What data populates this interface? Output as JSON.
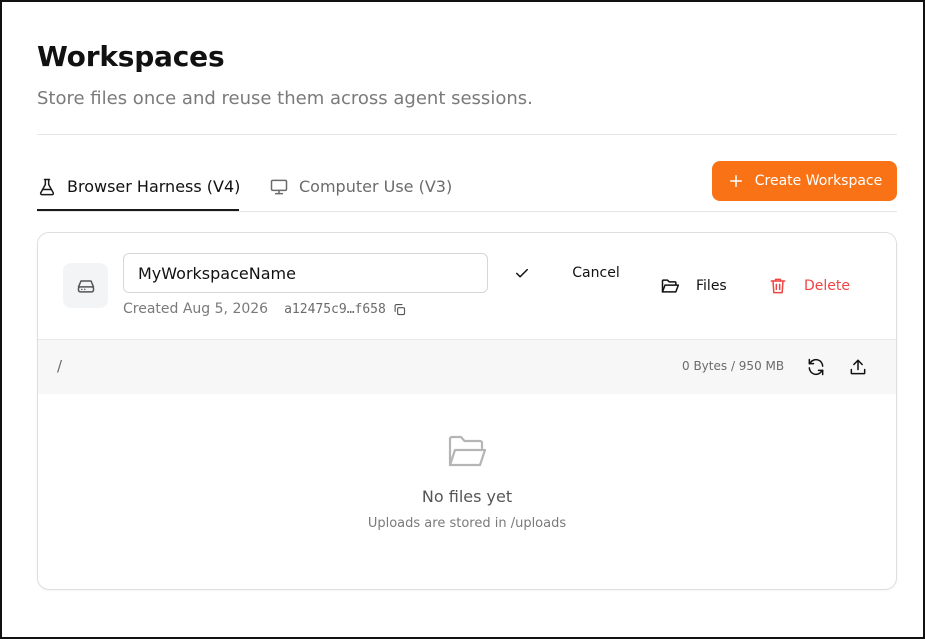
{
  "header": {
    "title": "Workspaces",
    "subtitle": "Store files once and reuse them across agent sessions."
  },
  "tabs": [
    {
      "label": "Browser Harness (V4)",
      "icon": "flask-icon",
      "active": true
    },
    {
      "label": "Computer Use (V3)",
      "icon": "monitor-icon",
      "active": false
    }
  ],
  "actions": {
    "create_label": "Create Workspace",
    "create_icon": "plus-icon"
  },
  "workspace": {
    "name_value": "MyWorkspaceName",
    "created": "Created Aug 5, 2026",
    "hash": "a12475c9…f658",
    "cancel_label": "Cancel",
    "files_label": "Files",
    "delete_label": "Delete"
  },
  "file_browser": {
    "path": "/",
    "usage": "0 Bytes / 950 MB",
    "empty_title": "No files yet",
    "empty_subtitle": "Uploads are stored in /uploads"
  },
  "colors": {
    "accent": "#f97316",
    "danger": "#ef4444",
    "muted_text": "#7a7a7a",
    "border": "#dedede"
  }
}
